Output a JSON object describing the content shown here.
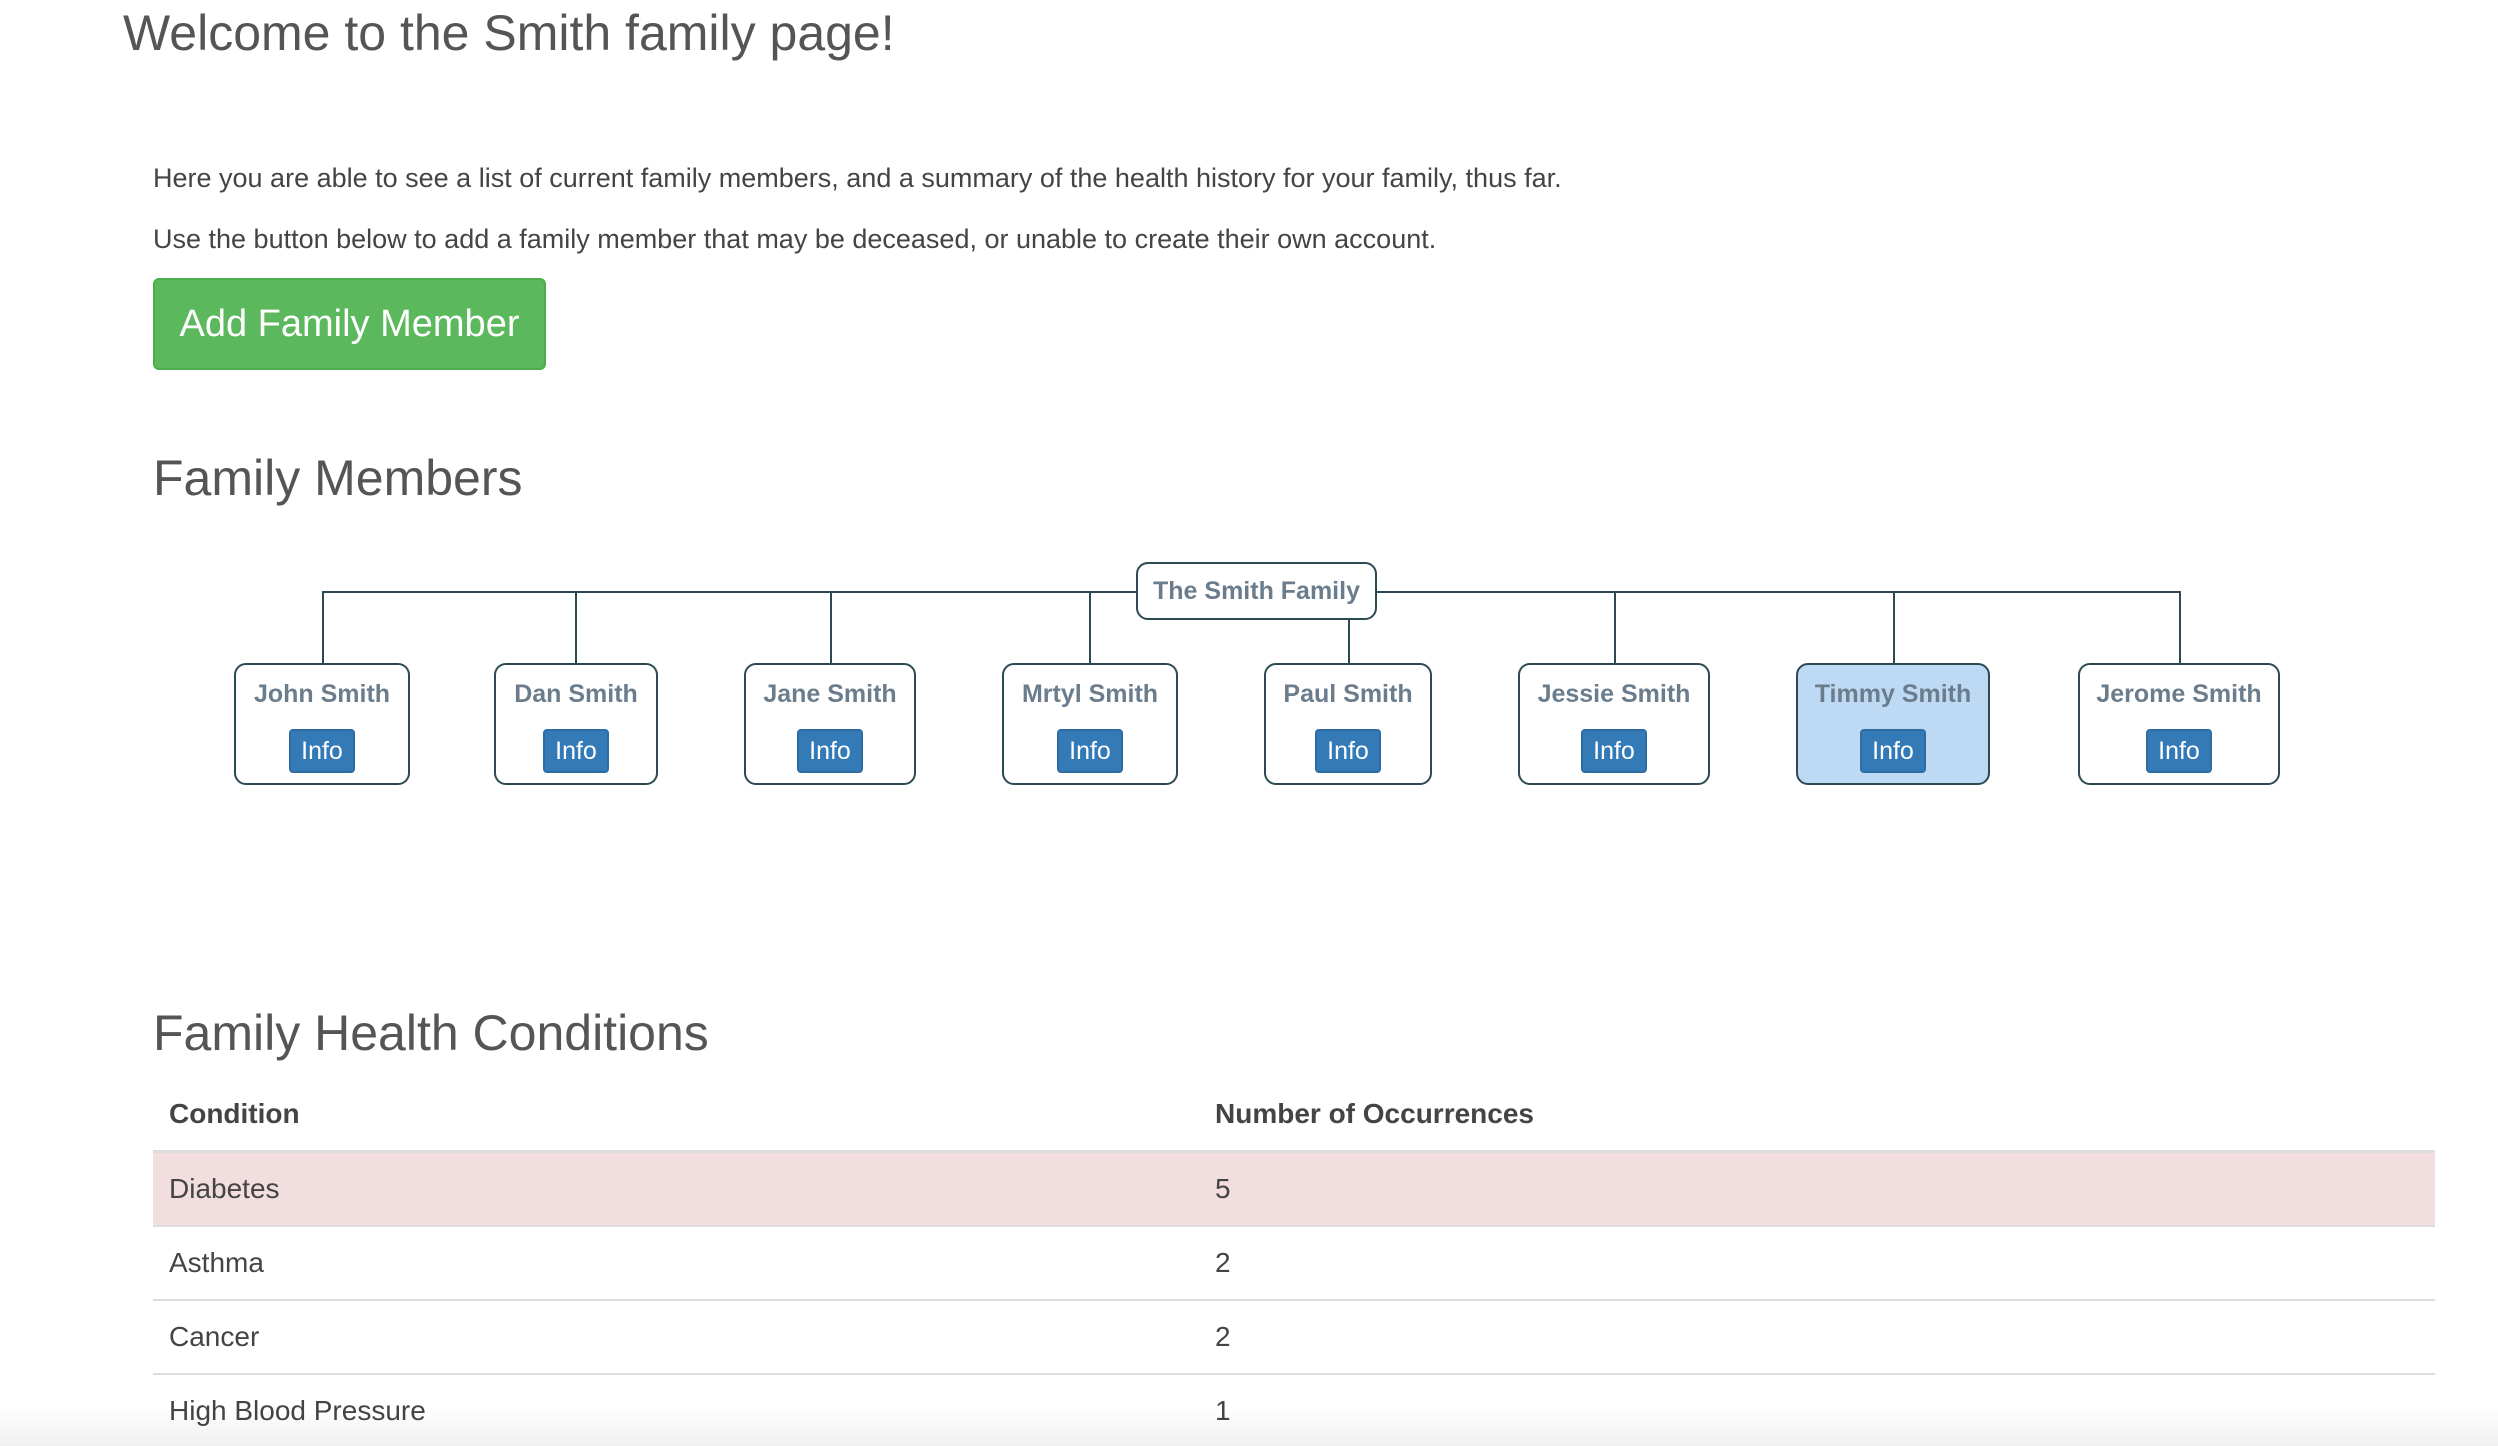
{
  "page": {
    "welcome": "Welcome to the Smith family page!",
    "intro_line_1": "Here you are able to see a list of current family members, and a summary of the health history for your family, thus far.",
    "intro_line_2": "Use the button below to add a family member that may be deceased, or unable to create their own account.",
    "add_button_label": "Add Family Member"
  },
  "family_members": {
    "title": "Family Members",
    "root_label": "The Smith Family",
    "info_label": "Info",
    "members": [
      {
        "name": "John Smith",
        "highlighted": false
      },
      {
        "name": "Dan Smith",
        "highlighted": false
      },
      {
        "name": "Jane Smith",
        "highlighted": false
      },
      {
        "name": "Mrtyl Smith",
        "highlighted": false
      },
      {
        "name": "Paul Smith",
        "highlighted": false
      },
      {
        "name": "Jessie Smith",
        "highlighted": false
      },
      {
        "name": "Timmy Smith",
        "highlighted": true
      },
      {
        "name": "Jerome Smith",
        "highlighted": false
      }
    ]
  },
  "health_conditions": {
    "title": "Family Health Conditions",
    "columns": [
      "Condition",
      "Number of Occurrences"
    ],
    "rows": [
      {
        "condition": "Diabetes",
        "count": "5",
        "highlighted": true
      },
      {
        "condition": "Asthma",
        "count": "2",
        "highlighted": false
      },
      {
        "condition": "Cancer",
        "count": "2",
        "highlighted": false
      },
      {
        "condition": "High Blood Pressure",
        "count": "1",
        "highlighted": false
      }
    ]
  },
  "colors": {
    "success": "#5cb85c",
    "primary": "#337ab7",
    "highlight_node": "#bdd9f3",
    "danger_row": "#f2dede",
    "tree_line": "#2c4a52"
  }
}
